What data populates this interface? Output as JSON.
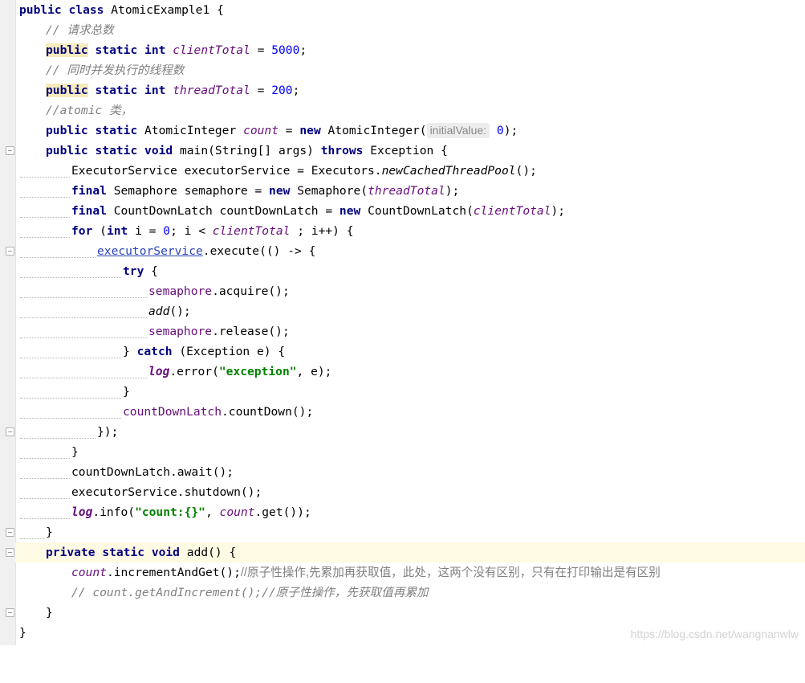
{
  "editor": {
    "lines": {
      "l1": {
        "kw1": "public",
        "kw2": "class",
        "name": "AtomicExample1",
        "brace": "{"
      },
      "l2": {
        "comment": "// 请求总数"
      },
      "l3": {
        "kw1": "public",
        "kw2": "static",
        "kw3": "int",
        "field": "clientTotal",
        "eq": "=",
        "num": "5000",
        "semi": ";"
      },
      "l4": {
        "comment": "// 同时并发执行的线程数"
      },
      "l5": {
        "kw1": "public",
        "kw2": "static",
        "kw3": "int",
        "field": "threadTotal",
        "eq": "=",
        "num": "200",
        "semi": ";"
      },
      "l6": {
        "comment": "//atomic 类，"
      },
      "l7": {
        "kw1": "public",
        "kw2": "static",
        "type": "AtomicInteger",
        "field": "count",
        "eq": "=",
        "kw3": "new",
        "ctor": "AtomicInteger(",
        "hint": "initialValue:",
        "num": "0",
        "close": ");"
      },
      "l8": {
        "kw1": "public",
        "kw2": "static",
        "kw3": "void",
        "sig": "main(String[] args)",
        "kw4": "throws",
        "tail": "Exception {"
      },
      "l9": {
        "pre": "ExecutorService executorService = Executors.",
        "method": "newCachedThreadPool",
        "post": "();"
      },
      "l10": {
        "kw": "final",
        "pre": "Semaphore semaphore =",
        "kw2": "new",
        "ctor": "Semaphore(",
        "field": "threadTotal",
        "post": ");"
      },
      "l11": {
        "kw": "final",
        "pre": "CountDownLatch countDownLatch =",
        "kw2": "new",
        "ctor": "CountDownLatch(",
        "field": "clientTotal",
        "post": ");"
      },
      "l12": {
        "kw": "for",
        "open": "(",
        "kw2": "int",
        "pre": "i =",
        "num": "0",
        "mid": "; i <",
        "field": "clientTotal",
        "post": "; i++) {"
      },
      "l13": {
        "var": "executorService",
        "post": ".execute(() -> {"
      },
      "l14": {
        "kw": "try",
        "post": "{"
      },
      "l15": {
        "var": "semaphore",
        "post": ".acquire();"
      },
      "l16": {
        "method": "add",
        "post": "();"
      },
      "l17": {
        "var": "semaphore",
        "post": ".release();"
      },
      "l18": {
        "pre": "}",
        "kw": "catch",
        "post": "(Exception e) {"
      },
      "l19": {
        "field": "log",
        "pre": ".error(",
        "str": "\"exception\"",
        "post": ", e);"
      },
      "l20": {
        "text": "}"
      },
      "l21": {
        "var": "countDownLatch",
        "post": ".countDown();"
      },
      "l22": {
        "text": "});"
      },
      "l23": {
        "text": "}"
      },
      "l24": {
        "text": "countDownLatch.await();"
      },
      "l25": {
        "text": "executorService.shutdown();"
      },
      "l26": {
        "field": "log",
        "pre": ".info(",
        "str": "\"count:{}\"",
        "mid": ",",
        "field2": "count",
        "post": ".get());"
      },
      "l27": {
        "text": "}"
      },
      "l28": {
        "kw1": "private",
        "kw2": "static",
        "kw3": "void",
        "post": "add() {"
      },
      "l29": {
        "field": "count",
        "code": ".incrementAndGet();",
        "comment": "//原子性操作,先累加再获取值，此处，这两个没有区别，只有在打印输出是有区别"
      },
      "l30": {
        "comment": "// count.getAndIncrement();//原子性操作，先获取值再累加"
      },
      "l31": {
        "text": "}"
      },
      "l32": {
        "text": "}"
      }
    }
  },
  "watermark": "https://blog.csdn.net/wangnanwlw"
}
